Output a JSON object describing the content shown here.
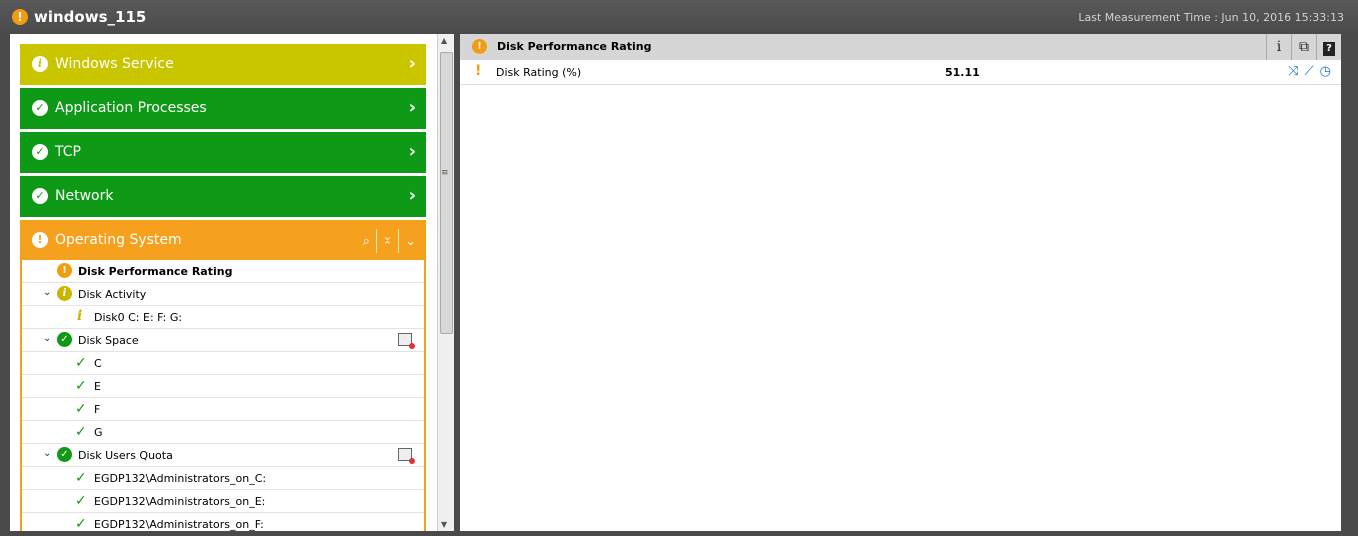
{
  "header": {
    "title": "windows_115",
    "last_measurement": "Last Measurement Time : Jun 10, 2016 15:33:13"
  },
  "categories": [
    {
      "label": "Windows Service",
      "status": "info"
    },
    {
      "label": "Application Processes",
      "status": "ok"
    },
    {
      "label": "TCP",
      "status": "ok"
    },
    {
      "label": "Network",
      "status": "ok"
    },
    {
      "label": "Operating System",
      "status": "warning"
    }
  ],
  "tree": {
    "disk_performance_rating": "Disk Performance Rating",
    "disk_activity": "Disk Activity",
    "disk0": "Disk0 C: E: F: G:",
    "disk_space": "Disk Space",
    "drives": [
      "C",
      "E",
      "F",
      "G"
    ],
    "disk_users_quota": "Disk Users Quota",
    "quota_items": [
      "EGDP132\\Administrators_on_C:",
      "EGDP132\\Administrators_on_E:",
      "EGDP132\\Administrators_on_F:"
    ]
  },
  "detail": {
    "title": "Disk Performance Rating",
    "measure_name": "Disk Rating (%)",
    "measure_value": "51.11"
  },
  "colors": {
    "info": "#c9c600",
    "ok": "#0e9a16",
    "warning": "#f6a11e"
  }
}
